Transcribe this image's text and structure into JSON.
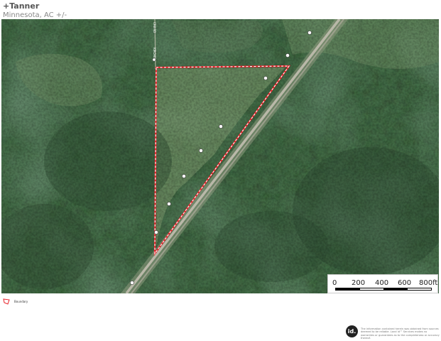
{
  "header": {
    "title": "+Tanner",
    "subtitle": "Minnesota,  AC +/-"
  },
  "map": {
    "type": "satellite",
    "boundary_color": "#e8222a",
    "boundary_style": "white dashed line with red outline",
    "road_markers": [
      "⊕",
      "⊕",
      "⊕",
      "⊕",
      "⊕",
      "⊕",
      "⊕",
      "⊕",
      "⊕",
      "⊕"
    ]
  },
  "scalebar": {
    "labels": [
      "0",
      "200",
      "400",
      "600",
      "800ft"
    ]
  },
  "legend": {
    "items": [
      {
        "label": "Boundary",
        "color": "#e8222a"
      }
    ]
  },
  "footer": {
    "logo_text": "id.",
    "disclaimer": "The information contained herein was obtained from sources deemed to be reliable. Land id™ Services makes no warranties or guarantees as to the completeness or accuracy thereof."
  }
}
